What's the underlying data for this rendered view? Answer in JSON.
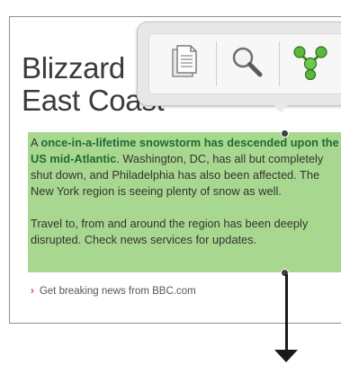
{
  "article": {
    "headline_line1": "Blizzard",
    "headline_line2": "East Coast",
    "para1_lead": "A ",
    "para1_bold1": "once-in-a-lifetime snowstorm has descended upon the US mid-Atlantic",
    "para1_rest": ". Washington, DC, has all but completely shut down, and Philadelphia has also been affected. The New York region is seeing plenty of snow as well.",
    "para2": "Travel to, from and around the region has been deeply disrupted. Check news services for updates.",
    "footer_link": "Get breaking news from BBC.com"
  },
  "popup": {
    "tools": [
      {
        "icon": "copy-icon"
      },
      {
        "icon": "search-icon"
      },
      {
        "icon": "share-icon"
      }
    ]
  },
  "colors": {
    "selection": "#a8d88f",
    "bold_text": "#1f6b33",
    "link_chevron": "#d9531e"
  }
}
